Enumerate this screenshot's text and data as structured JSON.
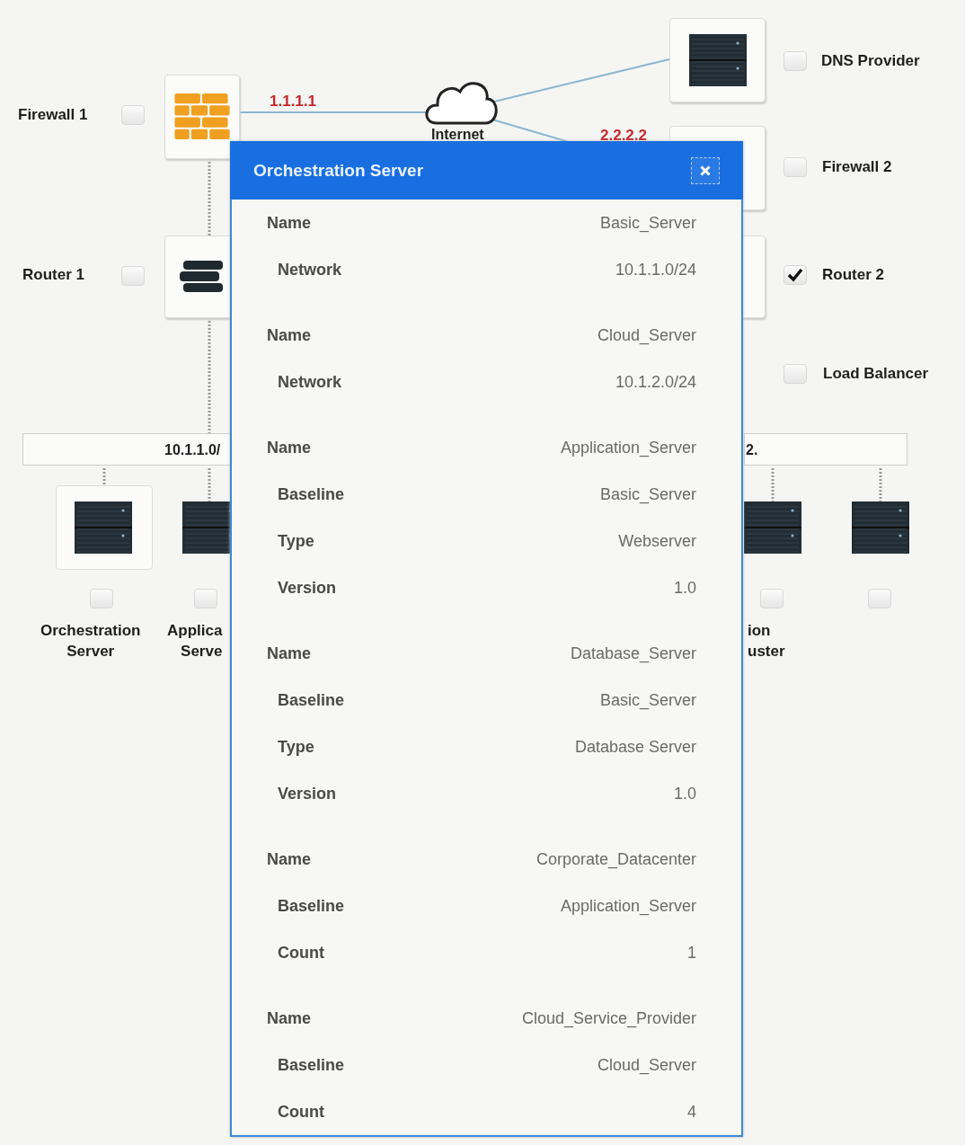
{
  "diagram": {
    "cloud_label": "Internet",
    "links": [
      "1.1.1.1",
      "2.2.2.2"
    ],
    "devices": [
      {
        "label": "Firewall 1",
        "checked": false,
        "kind": "firewall"
      },
      {
        "label": "Router 1",
        "checked": false,
        "kind": "router"
      },
      {
        "label": "DNS Provider",
        "checked": false,
        "kind": "server"
      },
      {
        "label": "Firewall 2",
        "checked": false
      },
      {
        "label": "Router 2",
        "checked": true
      },
      {
        "label": "Load Balancer",
        "checked": false
      }
    ],
    "subnets": [
      "10.1.1.0/",
      "2."
    ],
    "servers": [
      {
        "label_lines": [
          "Orchestration",
          "Server"
        ],
        "checked": false
      },
      {
        "label_lines": [
          "Applica",
          "Serve"
        ],
        "checked": false
      },
      {
        "label_lines": [
          "ion",
          "uster"
        ],
        "checked": false
      },
      {
        "checked": false
      }
    ]
  },
  "dialog": {
    "title": "Orchestration Server",
    "groups": [
      {
        "fields": [
          {
            "label": "Name",
            "value": "Basic_Server"
          },
          {
            "label": "Network",
            "value": "10.1.1.0/24"
          }
        ]
      },
      {
        "fields": [
          {
            "label": "Name",
            "value": "Cloud_Server"
          },
          {
            "label": "Network",
            "value": "10.1.2.0/24"
          }
        ]
      },
      {
        "fields": [
          {
            "label": "Name",
            "value": "Application_Server"
          },
          {
            "label": "Baseline",
            "value": "Basic_Server"
          },
          {
            "label": "Type",
            "value": "Webserver"
          },
          {
            "label": "Version",
            "value": "1.0"
          }
        ]
      },
      {
        "fields": [
          {
            "label": "Name",
            "value": "Database_Server"
          },
          {
            "label": "Baseline",
            "value": "Basic_Server"
          },
          {
            "label": "Type",
            "value": "Database Server"
          },
          {
            "label": "Version",
            "value": "1.0"
          }
        ]
      },
      {
        "fields": [
          {
            "label": "Name",
            "value": "Corporate_Datacenter"
          },
          {
            "label": "Baseline",
            "value": "Application_Server"
          },
          {
            "label": "Count",
            "value": "1"
          }
        ]
      },
      {
        "fields": [
          {
            "label": "Name",
            "value": "Cloud_Service_Provider"
          },
          {
            "label": "Baseline",
            "value": "Cloud_Server"
          },
          {
            "label": "Count",
            "value": "4"
          }
        ]
      }
    ]
  }
}
